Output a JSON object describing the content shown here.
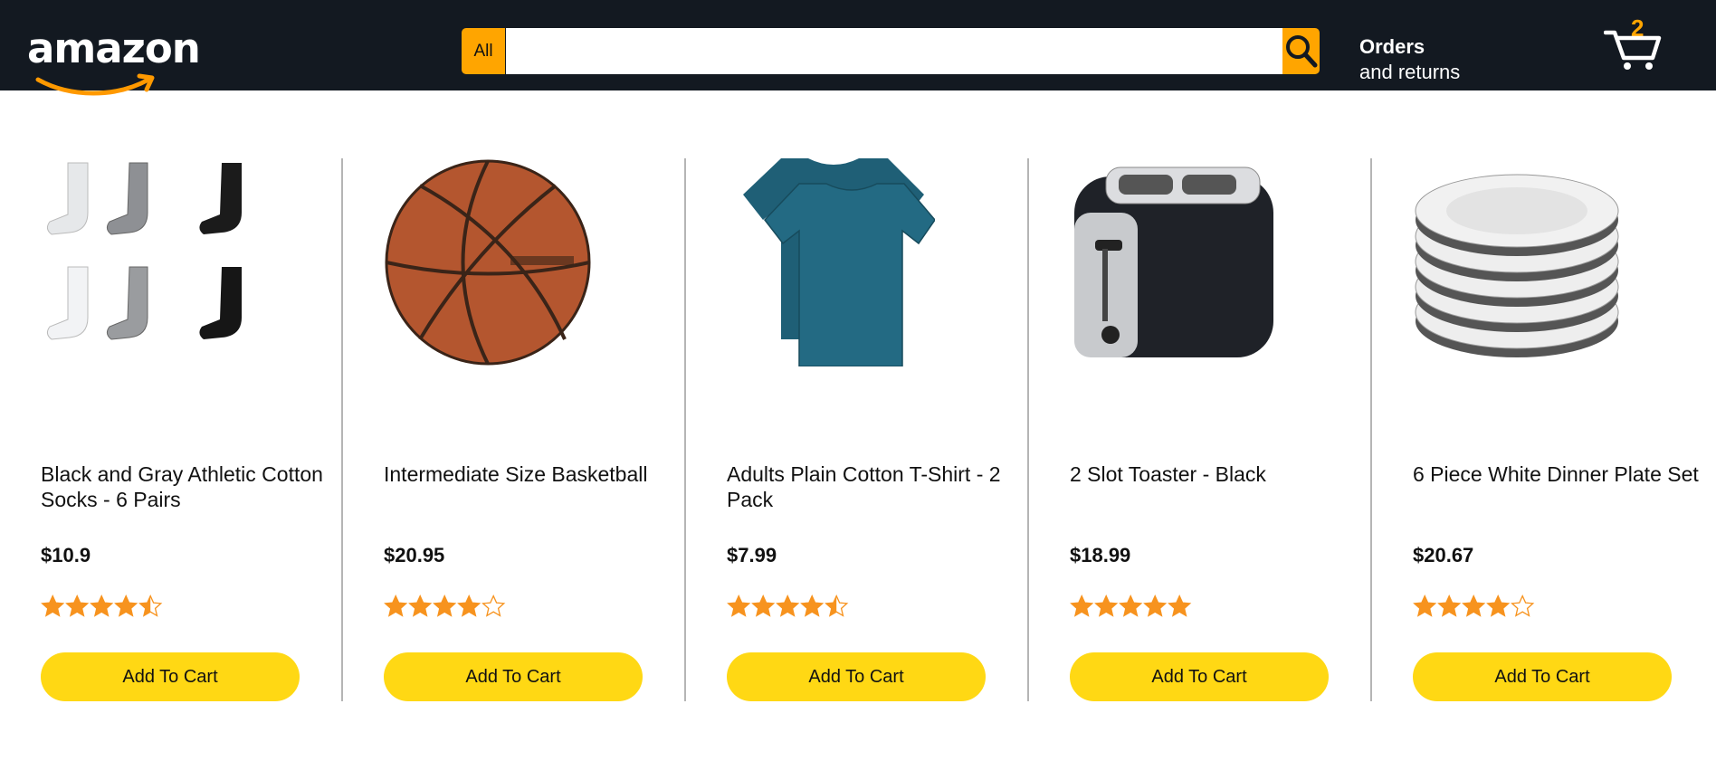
{
  "header": {
    "logo_text": "amazon",
    "search": {
      "category": "All",
      "value": "",
      "placeholder": ""
    },
    "orders_title": "Orders",
    "orders_sub": "and returns",
    "cart_count": "2",
    "colors": {
      "bar": "#131921",
      "accent": "#ffa500"
    },
    "icons": {
      "search": "search-icon",
      "cart": "cart-icon"
    }
  },
  "products": [
    {
      "title": "Black and Gray Athletic Cotton Socks - 6 Pairs",
      "price": "$10.9",
      "rating": 4.5,
      "button_label": "Add To Cart",
      "image": "socks-image"
    },
    {
      "title": "Intermediate Size Basketball",
      "price": "$20.95",
      "rating": 4,
      "button_label": "Add To Cart",
      "image": "basketball-image"
    },
    {
      "title": "Adults Plain Cotton T-Shirt - 2 Pack",
      "price": "$7.99",
      "rating": 4.5,
      "button_label": "Add To Cart",
      "image": "tshirt-image"
    },
    {
      "title": "2 Slot Toaster - Black",
      "price": "$18.99",
      "rating": 5,
      "button_label": "Add To Cart",
      "image": "toaster-image"
    },
    {
      "title": "6 Piece White Dinner Plate Set",
      "price": "$20.67",
      "rating": 4,
      "button_label": "Add To Cart",
      "image": "plates-image"
    }
  ],
  "colors": {
    "add_button": "#ffd814",
    "star": "#f7931e"
  }
}
